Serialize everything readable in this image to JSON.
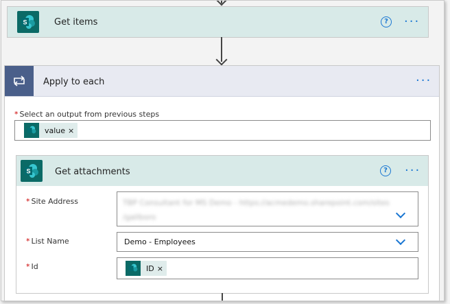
{
  "get_items": {
    "title": "Get items"
  },
  "apply_to_each": {
    "title": "Apply to each",
    "output_label": "Select an output from previous steps",
    "output_token": "value"
  },
  "get_attachments": {
    "title": "Get attachments",
    "site_address_label": "Site Address",
    "site_address_line1": "TBP Consultant for MS Demo - https://acmedemo.sharepoint.com/sites",
    "site_address_line2": "/gallboro",
    "list_name_label": "List Name",
    "list_name_value": "Demo - Employees",
    "id_label": "Id",
    "id_token": "ID"
  },
  "glyphs": {
    "help": "?",
    "more": "···",
    "remove": "×"
  },
  "icons": [
    "sharepoint-icon",
    "help-icon",
    "more-options-icon",
    "loop-icon",
    "chevron-down-icon",
    "close-icon"
  ],
  "colors": {
    "sharepoint_teal": "#0b6a66",
    "header_teal": "#d8eae8",
    "accent_blue": "#1976d2",
    "loop_blue": "#4a5f8a"
  }
}
